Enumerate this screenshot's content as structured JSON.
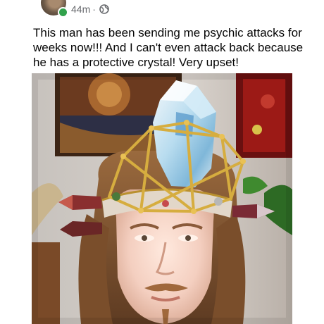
{
  "post": {
    "timestamp": "44m",
    "separator": "·",
    "privacy_icon": "globe-icon",
    "caption": "This man has been sending me psychic attacks for weeks now!!! And I can't even attack back because he has a protective crystal! Very upset!",
    "photo_icon": "photo-man-with-crystal-crown"
  },
  "colors": {
    "online_status": "#31a24c",
    "meta_text": "#65676b",
    "text": "#050505"
  }
}
